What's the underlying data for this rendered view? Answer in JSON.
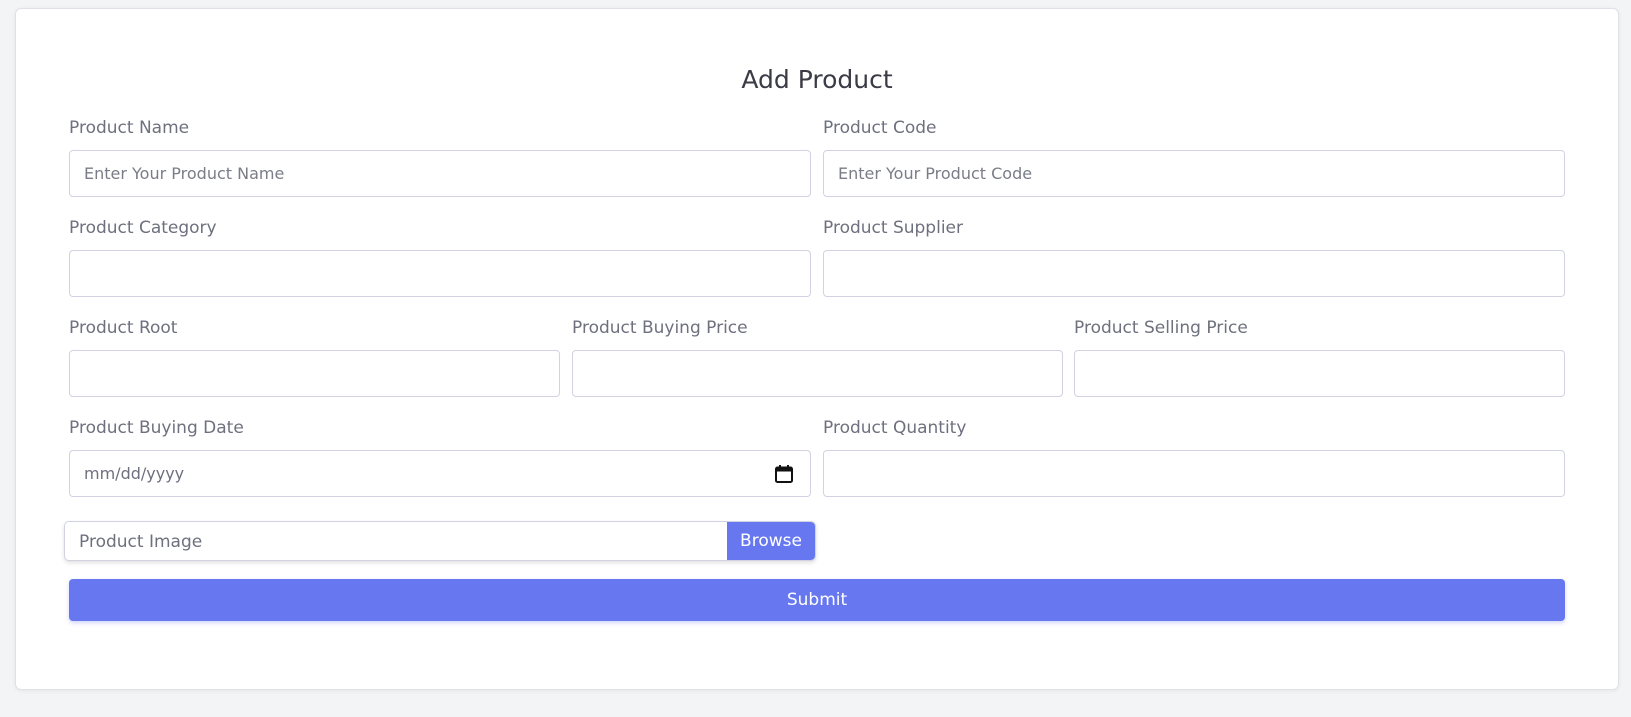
{
  "form": {
    "title": "Add Product",
    "product_name": {
      "label": "Product Name",
      "placeholder": "Enter Your Product Name",
      "value": ""
    },
    "product_code": {
      "label": "Product Code",
      "placeholder": "Enter Your Product Code",
      "value": ""
    },
    "product_category": {
      "label": "Product Category",
      "value": ""
    },
    "product_supplier": {
      "label": "Product Supplier",
      "value": ""
    },
    "product_root": {
      "label": "Product Root",
      "value": ""
    },
    "product_buying_price": {
      "label": "Product Buying Price",
      "value": ""
    },
    "product_selling_price": {
      "label": "Product Selling Price",
      "value": ""
    },
    "product_buying_date": {
      "label": "Product Buying Date",
      "placeholder": "mm/dd/yyyy",
      "icon": "calendar-icon"
    },
    "product_quantity": {
      "label": "Product Quantity",
      "value": ""
    },
    "product_image": {
      "label": "Product Image",
      "browse_label": "Browse"
    },
    "submit_label": "Submit"
  },
  "colors": {
    "accent": "#6777ef",
    "background": "#f3f4f6",
    "card": "#ffffff",
    "border": "#d1d3e2"
  }
}
